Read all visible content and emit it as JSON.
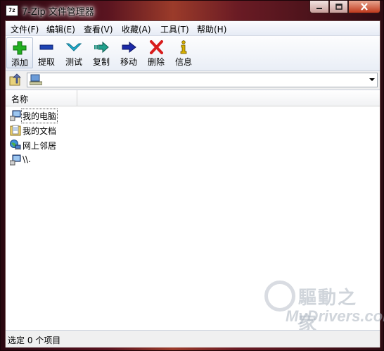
{
  "window": {
    "app_icon_text": "7z",
    "title": "7-Zip 文件管理器"
  },
  "menu": [
    "文件(F)",
    "编辑(E)",
    "查看(V)",
    "收藏(A)",
    "工具(T)",
    "帮助(H)"
  ],
  "toolbar": [
    {
      "label": "添加",
      "icon": "plus-icon",
      "color": "#1aa51a"
    },
    {
      "label": "提取",
      "icon": "minus-icon",
      "color": "#1a3ea8"
    },
    {
      "label": "测试",
      "icon": "check-chevron-icon",
      "color": "#17a6c8"
    },
    {
      "label": "复制",
      "icon": "copy-arrow-icon",
      "color": "#1a8a7a"
    },
    {
      "label": "移动",
      "icon": "move-arrow-icon",
      "color": "#1a2aa0"
    },
    {
      "label": "删除",
      "icon": "delete-x-icon",
      "color": "#d41a1a"
    },
    {
      "label": "信息",
      "icon": "info-icon",
      "color": "#c8a000"
    }
  ],
  "address": {
    "value": ""
  },
  "list": {
    "column_name": "名称",
    "items": [
      {
        "name": "我的电脑",
        "icon": "computer-icon",
        "focused": true
      },
      {
        "name": "我的文档",
        "icon": "documents-folder-icon",
        "focused": false
      },
      {
        "name": "网上邻居",
        "icon": "network-icon",
        "focused": false
      },
      {
        "name": "\\\\.",
        "icon": "computer-icon",
        "focused": false
      }
    ]
  },
  "status": "选定 0 个项目",
  "watermark": {
    "cn": "驅動之家",
    "en": "MyDrivers.com"
  }
}
